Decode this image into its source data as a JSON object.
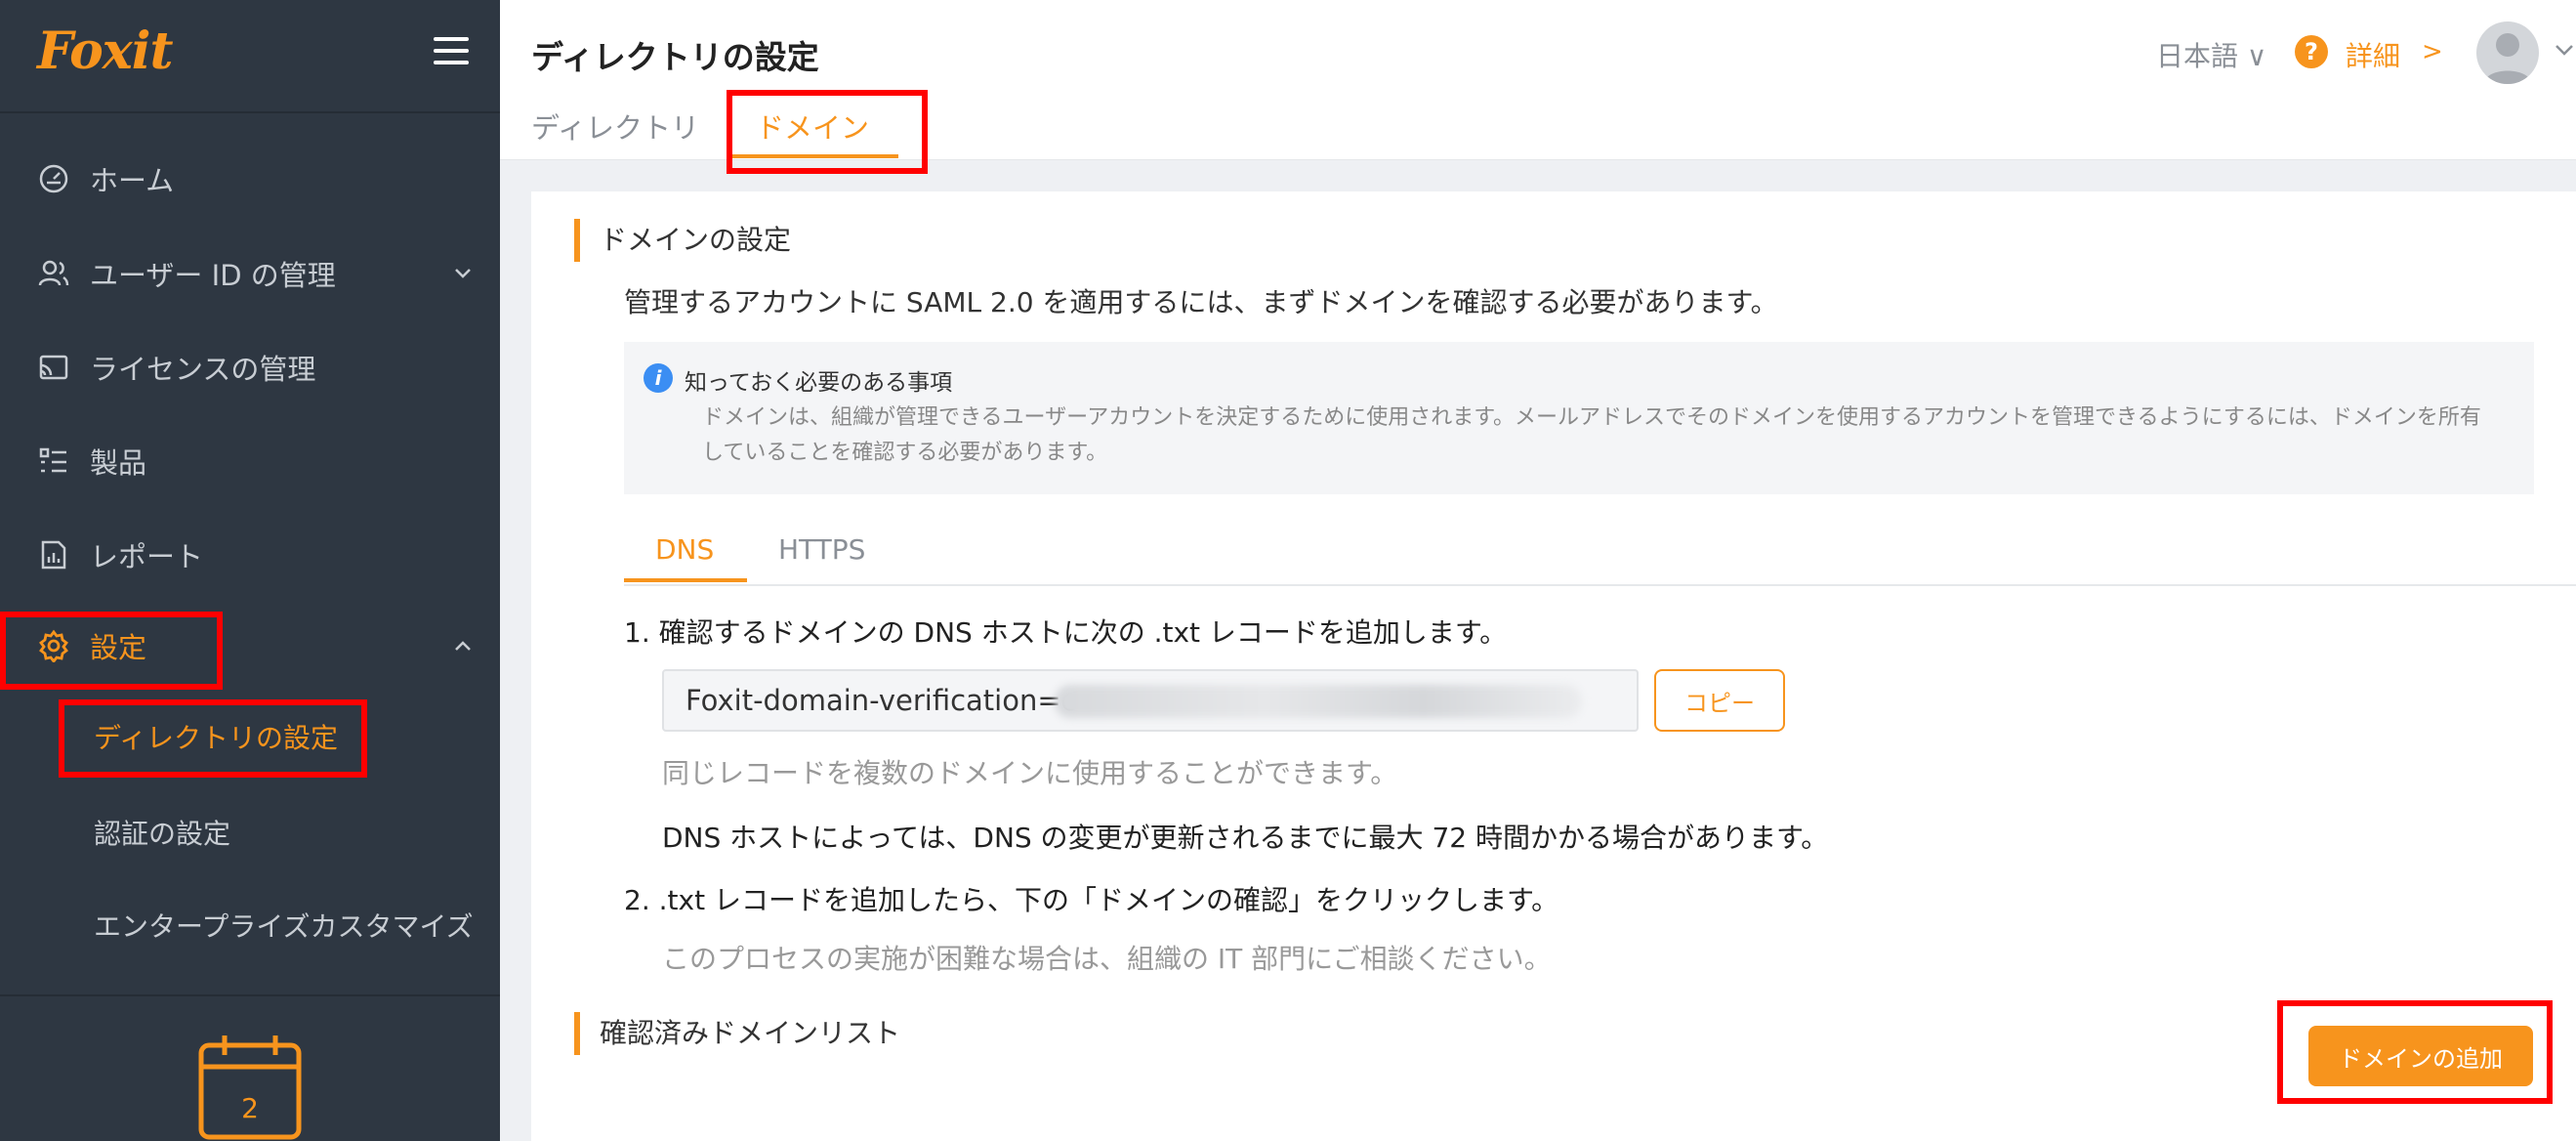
{
  "sidebar": {
    "logo": "Foxit",
    "items": [
      {
        "label": "ホーム",
        "icon": "dashboard-icon"
      },
      {
        "label": "ユーザー ID の管理",
        "icon": "users-icon"
      },
      {
        "label": "ライセンスの管理",
        "icon": "license-icon"
      },
      {
        "label": "製品",
        "icon": "products-icon"
      },
      {
        "label": "レポート",
        "icon": "report-icon"
      },
      {
        "label": "設定",
        "icon": "gear-icon"
      }
    ],
    "settings_sub": [
      {
        "label": "ディレクトリの設定"
      },
      {
        "label": "認証の設定"
      },
      {
        "label": "エンタープライズカスタマイズ"
      }
    ],
    "calendar_day": "2"
  },
  "header": {
    "title": "ディレクトリの設定",
    "tabs": [
      "ディレクトリ",
      "ドメイン"
    ],
    "active_tab": "ドメイン",
    "language": "日本語 ∨",
    "help_label": "詳細",
    "help_arrow": ">"
  },
  "main": {
    "domain_settings_title": "ドメインの設定",
    "description": "管理するアカウントに SAML 2.0 を適用するには、まずドメインを確認する必要があります。",
    "info": {
      "title": "知っておく必要のある事項",
      "body": "ドメインは、組織が管理できるユーザーアカウントを決定するために使用されます。メールアドレスでそのドメインを使用するアカウントを管理できるようにするには、ドメインを所有していることを確認する必要があります。"
    },
    "method_tabs": [
      "DNS",
      "HTTPS"
    ],
    "active_method": "DNS",
    "step1": "1. 確認するドメインの DNS ホストに次の .txt レコードを追加します。",
    "txt_record": "Foxit-domain-verification=c",
    "copy_label": "コピー",
    "note_multi_domain": "同じレコードを複数のドメインに使用することができます。",
    "note_dns_delay": "DNS ホストによっては、DNS の変更が更新されるまでに最大 72 時間かかる場合があります。",
    "step2": "2. .txt レコードを追加したら、下の「ドメインの確認」をクリックします。",
    "note_contact_it": "このプロセスの実施が困難な場合は、組織の IT 部門にご相談ください。",
    "verified_list_title": "確認済みドメインリスト",
    "add_domain_label": "ドメインの追加"
  },
  "colors": {
    "accent": "#f7941d",
    "sidebar_bg": "#2e3742",
    "annotation": "#ff0000"
  }
}
